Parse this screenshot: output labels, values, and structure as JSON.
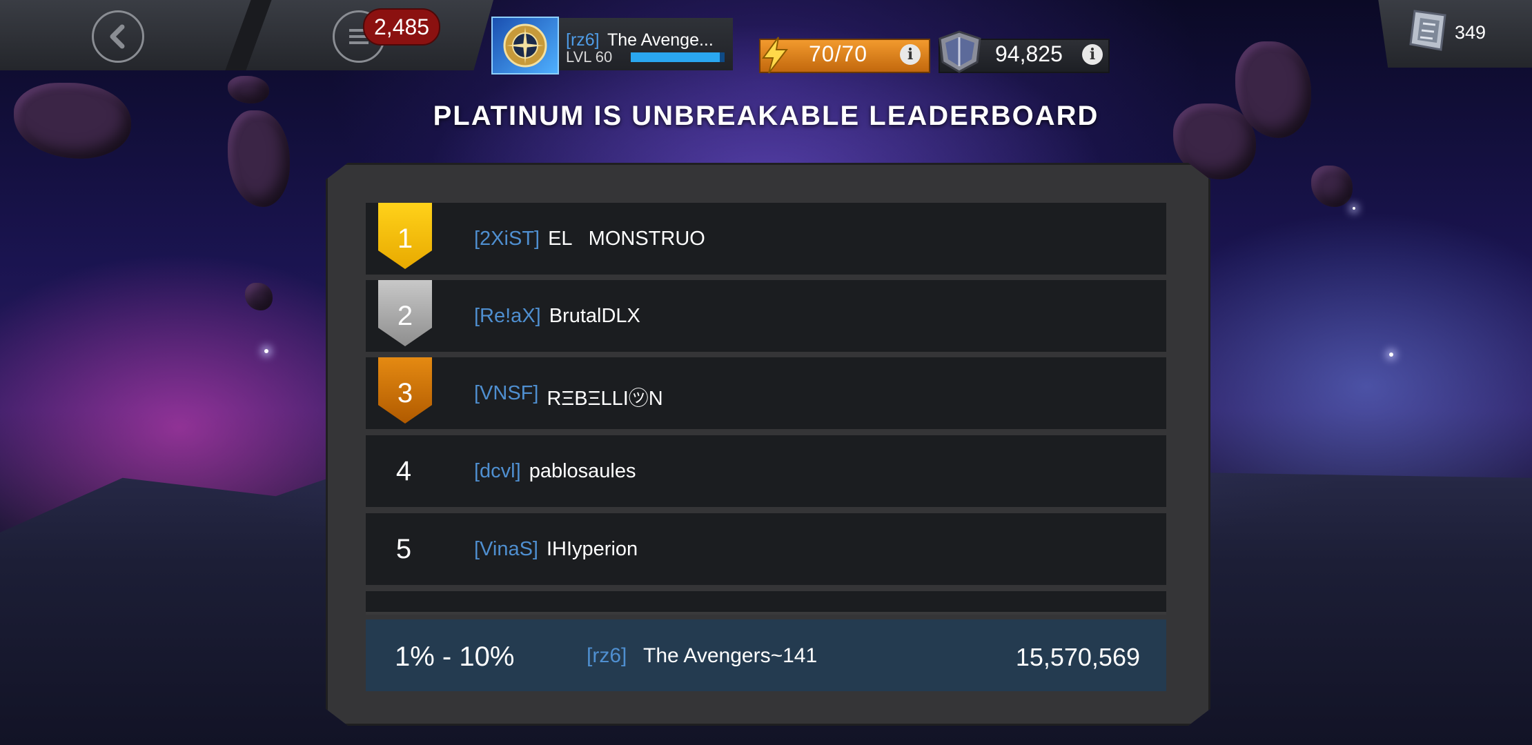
{
  "topbar": {
    "notification_count": "2,485",
    "profile": {
      "alliance_tag": "[rz6]",
      "name": "The Avenge...",
      "level": "LVL 60",
      "xp_fraction": 0.95
    },
    "energy": "70/70",
    "gold": "94,825",
    "units": "349"
  },
  "leaderboard": {
    "title": "PLATINUM IS UNBREAKABLE LEADERBOARD",
    "rows": [
      {
        "rank": "1",
        "tag": "[2XiST]",
        "name": "EL   MONSTRUO"
      },
      {
        "rank": "2",
        "tag": "[Re!aX]",
        "name": "BrutalDLX"
      },
      {
        "rank": "3",
        "tag": "[VNSF]",
        "name": "RΞBΞLLI㋡N"
      },
      {
        "rank": "4",
        "tag": "[dcvl]",
        "name": "pablosaules"
      },
      {
        "rank": "5",
        "tag": "[VinaS]",
        "name": "IHIyperion"
      }
    ],
    "my_entry": {
      "percentile": "1% - 10%",
      "tag": "[rz6]",
      "name": "The Avengers~141",
      "score": "15,570,569"
    }
  },
  "colors": {
    "gold_medal": "#ffd21a",
    "silver_medal": "#c8c8c8",
    "bronze_medal": "#e58a12",
    "alliance_tag": "#4f8fd0",
    "energy": "#f29a2e"
  }
}
